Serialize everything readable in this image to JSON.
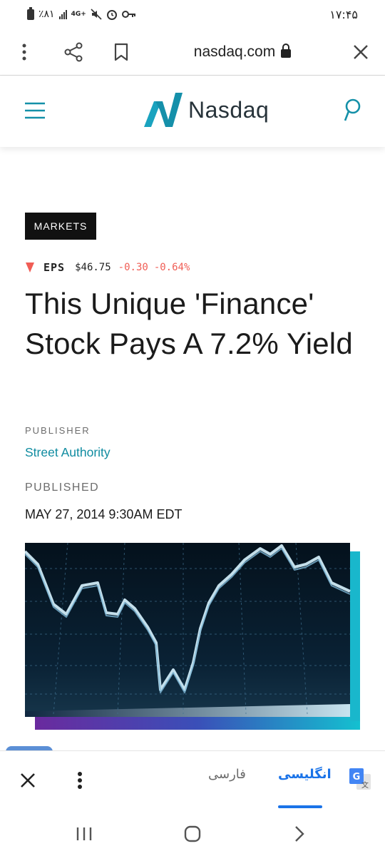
{
  "status_bar": {
    "battery_percent": "٪۸۱",
    "network": "4G+",
    "time": "۱۷:۴۵"
  },
  "browser": {
    "url": "nasdaq.com"
  },
  "site": {
    "brand": "Nasdaq"
  },
  "article": {
    "category": "MARKETS",
    "ticker": {
      "symbol": "EPS",
      "price": "$46.75",
      "change": "-0.30",
      "change_percent": "-0.64%",
      "direction": "down"
    },
    "headline": "This Unique 'Finance' Stock Pays A 7.2% Yield",
    "publisher_label": "PUBLISHER",
    "publisher": "Street Authority",
    "published_label": "PUBLISHED",
    "published_date": "MAY 27, 2014 9:30AM EDT"
  },
  "translate": {
    "languages": [
      "فارسی",
      "انگلیسی"
    ],
    "selected": "انگلیسی"
  },
  "colors": {
    "brand_teal": "#0e8ba0",
    "negative": "#f05d55",
    "translate_blue": "#1a73e8"
  }
}
